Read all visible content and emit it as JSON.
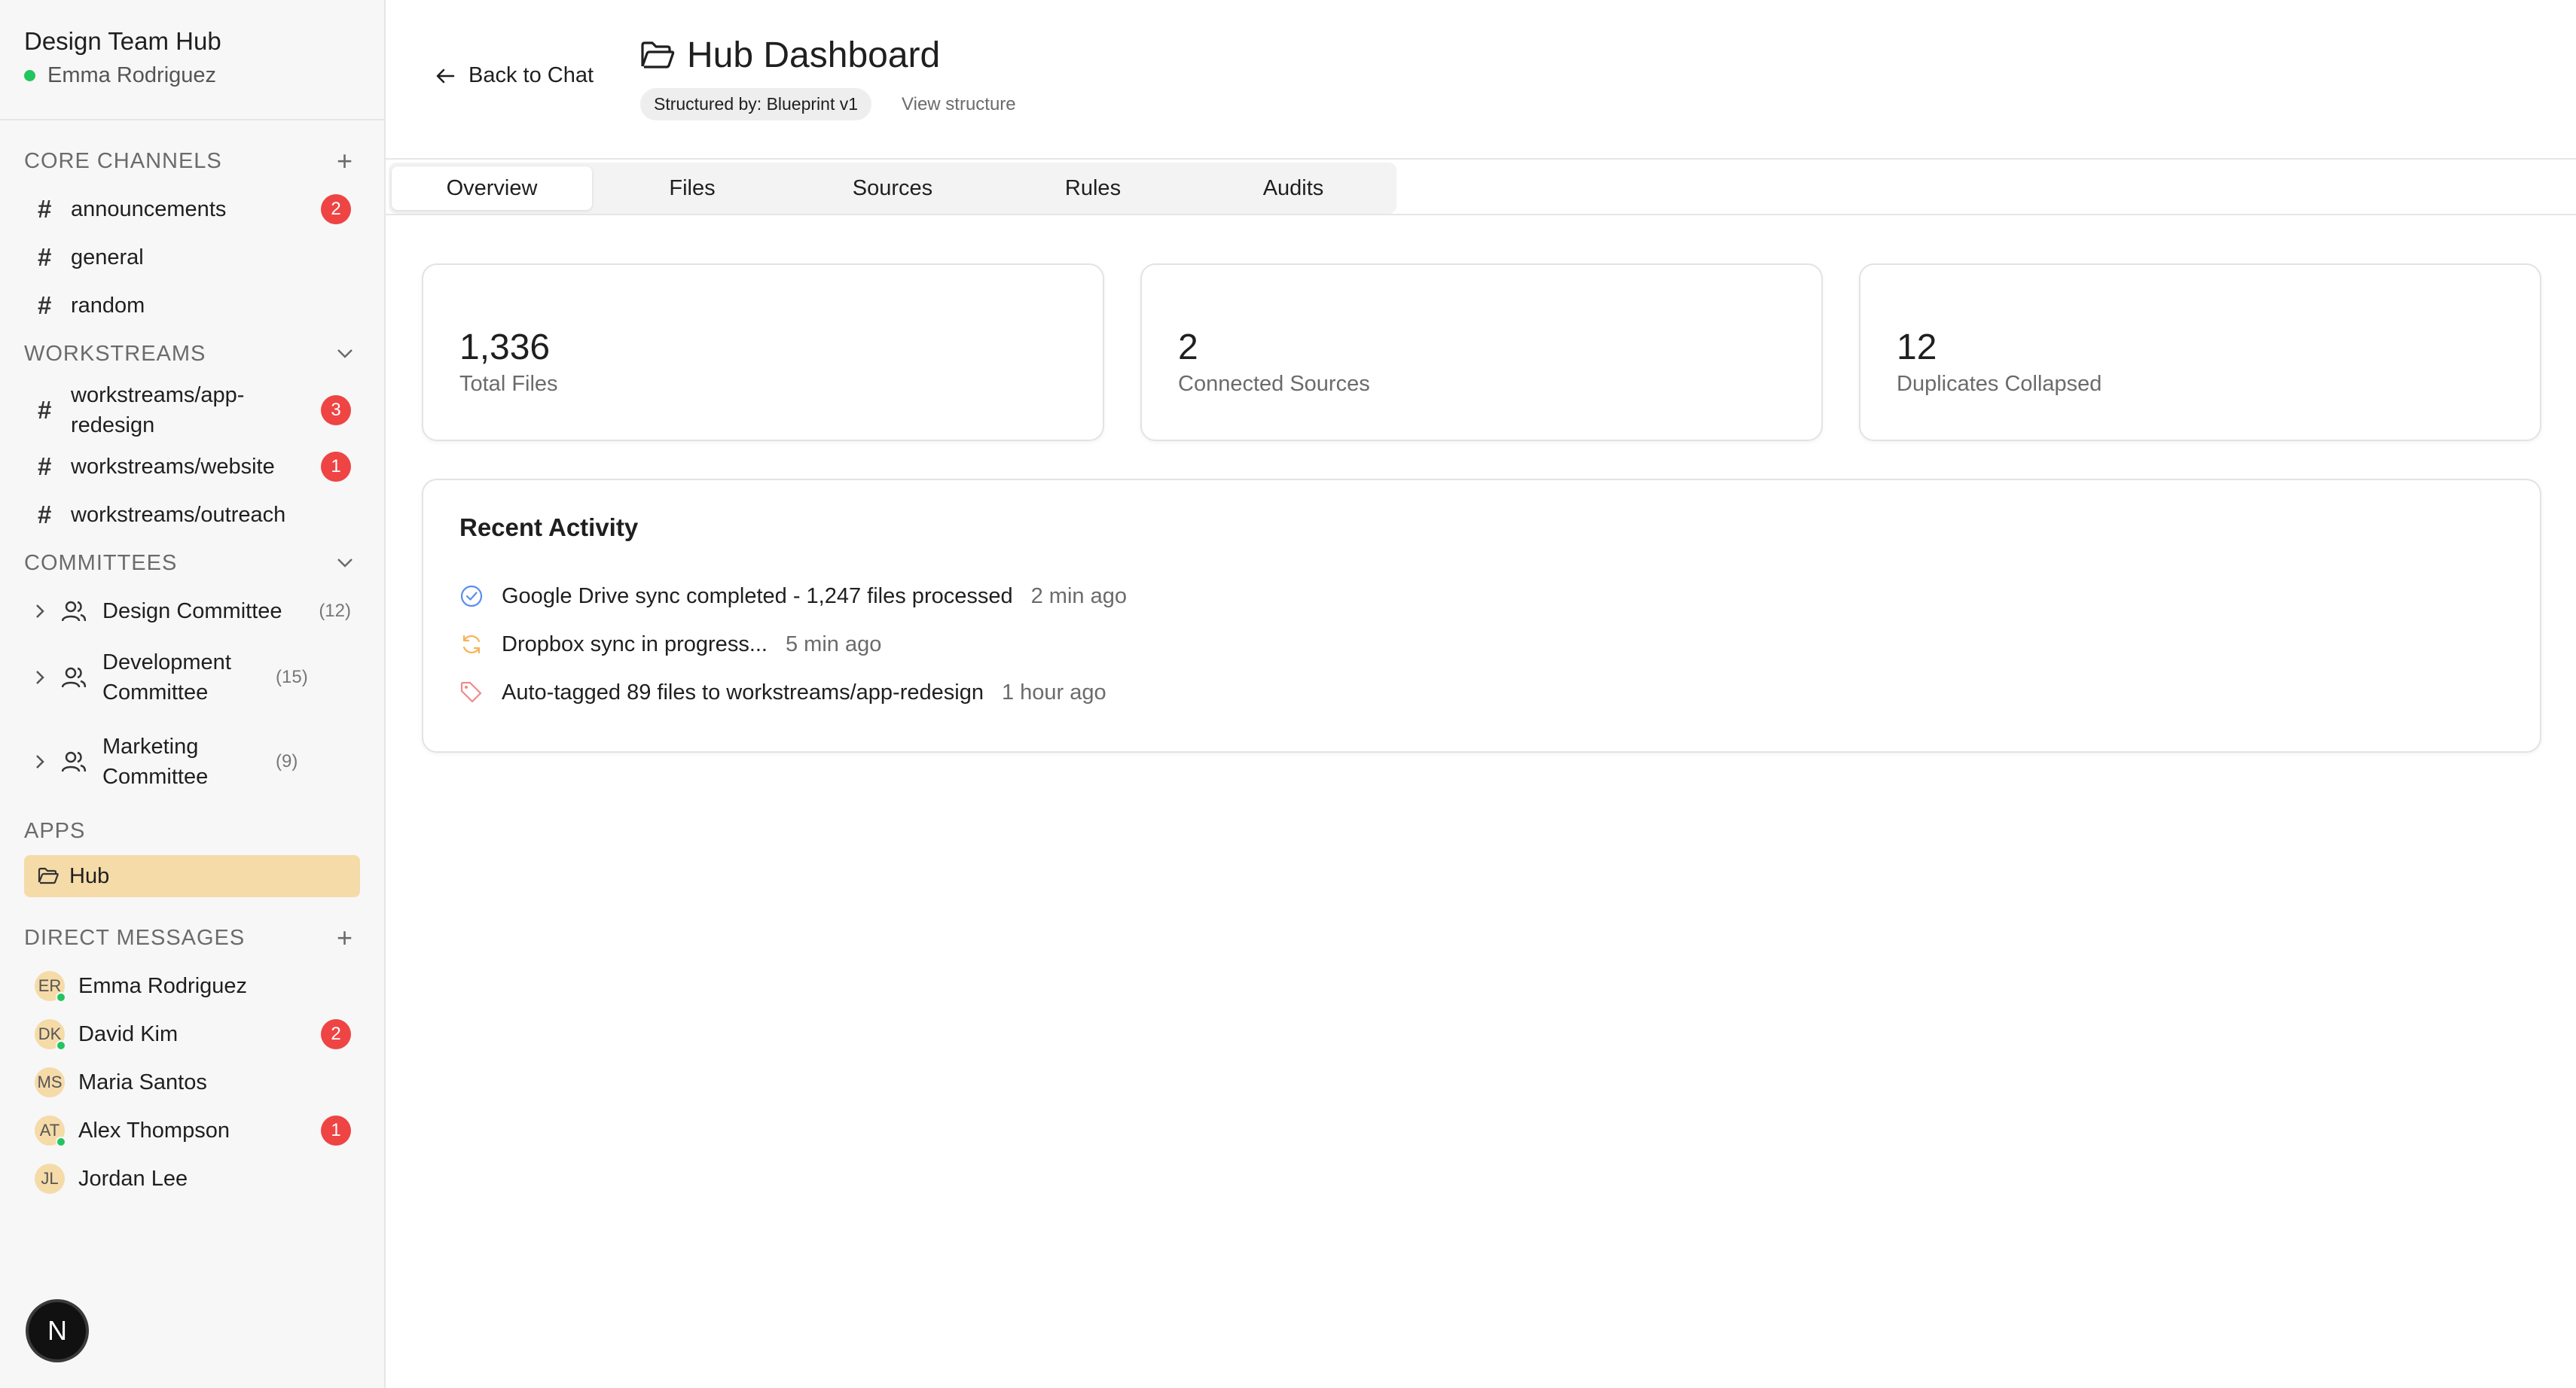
{
  "workspace": {
    "title": "Design Team Hub",
    "user": "Emma Rodriguez"
  },
  "sidebar": {
    "core_channels": {
      "heading": "CORE CHANNELS",
      "items": [
        {
          "label": "announcements",
          "badge": "2"
        },
        {
          "label": "general",
          "badge": ""
        },
        {
          "label": "random",
          "badge": ""
        }
      ]
    },
    "workstreams": {
      "heading": "WORKSTREAMS",
      "items": [
        {
          "label": "workstreams/app-redesign",
          "badge": "3"
        },
        {
          "label": "workstreams/website",
          "badge": "1"
        },
        {
          "label": "workstreams/outreach",
          "badge": ""
        }
      ]
    },
    "committees": {
      "heading": "COMMITTEES",
      "items": [
        {
          "label": "Design Committee",
          "count": "(12)"
        },
        {
          "label": "Development Committee",
          "count": "(15)"
        },
        {
          "label": "Marketing Committee",
          "count": "(9)"
        }
      ]
    },
    "apps": {
      "heading": "APPS",
      "items": [
        {
          "label": "Hub"
        }
      ]
    },
    "direct_messages": {
      "heading": "DIRECT MESSAGES",
      "items": [
        {
          "initials": "ER",
          "label": "Emma Rodriguez",
          "online": true,
          "badge": ""
        },
        {
          "initials": "DK",
          "label": "David Kim",
          "online": true,
          "badge": "2"
        },
        {
          "initials": "MS",
          "label": "Maria Santos",
          "online": false,
          "badge": ""
        },
        {
          "initials": "AT",
          "label": "Alex Thompson",
          "online": true,
          "badge": "1"
        },
        {
          "initials": "JL",
          "label": "Jordan Lee",
          "online": false,
          "badge": ""
        }
      ]
    },
    "logo_letter": "N"
  },
  "header": {
    "back_label": "Back to Chat",
    "title": "Hub Dashboard",
    "structured_by": "Structured by: Blueprint v1",
    "view_structure": "View structure"
  },
  "tabs": [
    {
      "label": "Overview",
      "active": true
    },
    {
      "label": "Files",
      "active": false
    },
    {
      "label": "Sources",
      "active": false
    },
    {
      "label": "Rules",
      "active": false
    },
    {
      "label": "Audits",
      "active": false
    }
  ],
  "stats": [
    {
      "value": "1,336",
      "label": "Total Files"
    },
    {
      "value": "2",
      "label": "Connected Sources"
    },
    {
      "value": "12",
      "label": "Duplicates Collapsed"
    }
  ],
  "activity": {
    "title": "Recent Activity",
    "items": [
      {
        "icon": "check-circle-icon",
        "text": "Google Drive sync completed - 1,247 files processed",
        "time": "2 min ago"
      },
      {
        "icon": "refresh-icon",
        "text": "Dropbox sync in progress...",
        "time": "5 min ago"
      },
      {
        "icon": "tag-icon",
        "text": "Auto-tagged 89 files to workstreams/app-redesign",
        "time": "1 hour ago"
      }
    ]
  },
  "colors": {
    "badge": "#ef4444",
    "online": "#22c55e",
    "active_app": "#f5dba8",
    "check": "#5b8def",
    "refresh": "#f5b357",
    "tag": "#ef8a8a"
  }
}
